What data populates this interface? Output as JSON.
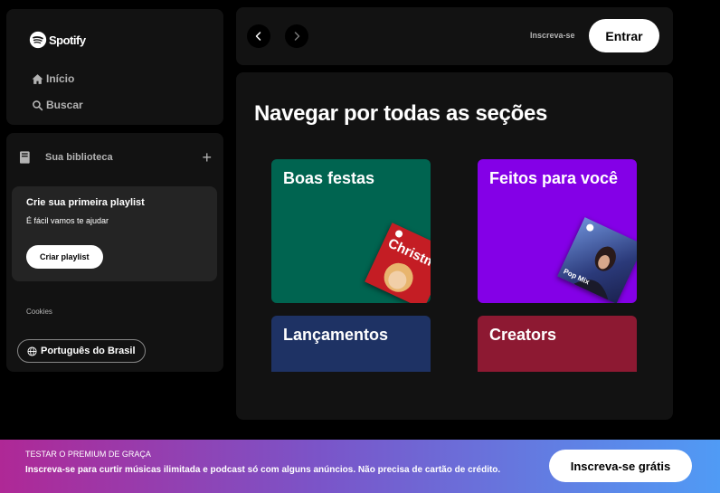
{
  "brand": {
    "name": "Spotify",
    "accent": "#1ed760"
  },
  "nav": {
    "items": [
      {
        "label": "Início",
        "icon": "home-icon"
      },
      {
        "label": "Buscar",
        "icon": "search-icon"
      }
    ]
  },
  "library": {
    "title": "Sua biblioteca",
    "add_icon": "+",
    "promo": {
      "title": "Crie sua primeira playlist",
      "subtitle": "É fácil vamos te ajudar",
      "button_label": "Criar playlist"
    },
    "cookies_label": "Cookies",
    "language_label": "Português do Brasil"
  },
  "header": {
    "signup_label": "Inscreva-se",
    "login_label": "Entrar"
  },
  "main": {
    "title": "Navegar por todas as seções",
    "tiles": [
      {
        "label": "Boas festas",
        "color": "#006450",
        "cover_text": "Christmas Hits"
      },
      {
        "label": "Feitos para você",
        "color": "#8400e7",
        "cover_text": "Pop Mix"
      },
      {
        "label": "Lançamentos",
        "color": "#1e3264"
      },
      {
        "label": "Creators",
        "color": "#8d1932"
      }
    ]
  },
  "banner": {
    "heading": "TESTAR O PREMIUM DE GRAÇA",
    "text": "Inscreva-se para curtir músicas ilimitada e podcast só com alguns anúncios. Não precisa de cartão de crédito.",
    "button_label": "Inscreva-se grátis"
  }
}
